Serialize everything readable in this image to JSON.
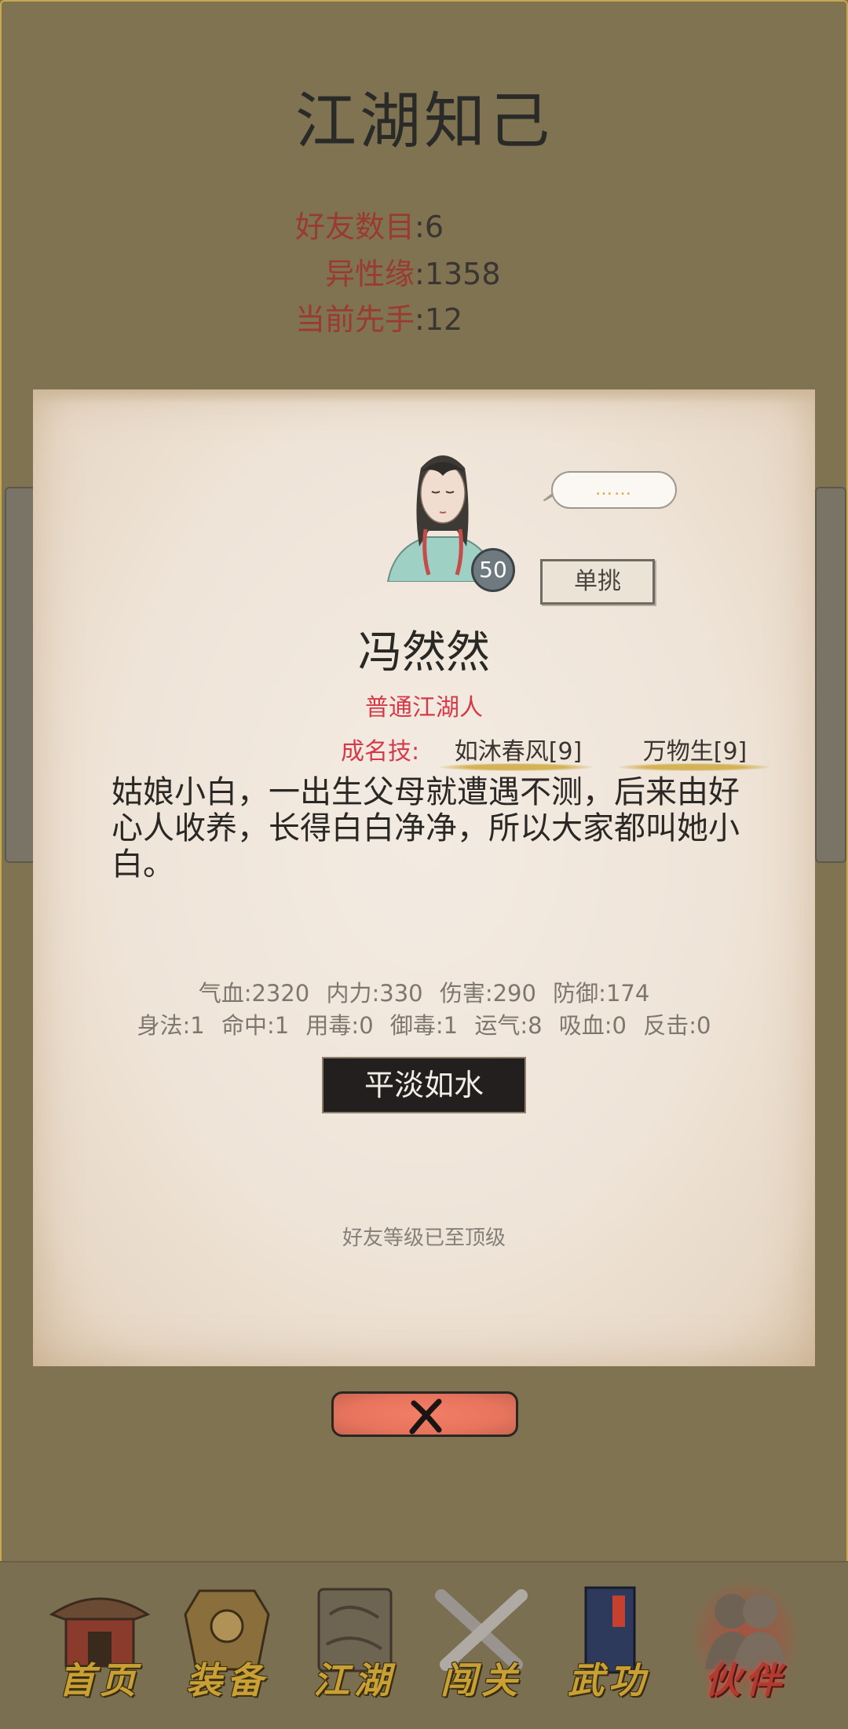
{
  "header": {
    "title": "江湖知己"
  },
  "stats": [
    {
      "label": "好友数目",
      "value": "6"
    },
    {
      "label": "异性缘",
      "value": "1358"
    },
    {
      "label": "当前先手",
      "value": "12"
    }
  ],
  "profile": {
    "level": "50",
    "speech": "……",
    "duel_label": "单挑",
    "name": "冯然然",
    "rank": "普通江湖人",
    "skills_label": "成名技:",
    "skills": [
      "如沐春风[9]",
      "万物生[9]"
    ],
    "bio": "姑娘小白，一出生父母就遭遇不测，后来由好心人收养，长得白白净净，所以大家都叫她小白。",
    "attrs_row1": [
      "气血:2320",
      "内力:330",
      "伤害:290",
      "防御:174"
    ],
    "attrs_row2": [
      "身法:1",
      "命中:1",
      "用毒:0",
      "御毒:1",
      "运气:8",
      "吸血:0",
      "反击:0"
    ],
    "mood_button": "平淡如水",
    "status_note": "好友等级已至顶级"
  },
  "nav": [
    {
      "label": "首页",
      "icon": "building-icon"
    },
    {
      "label": "装备",
      "icon": "armor-icon"
    },
    {
      "label": "江湖",
      "icon": "scroll-map-icon"
    },
    {
      "label": "闯关",
      "icon": "crossed-swords-icon"
    },
    {
      "label": "武功",
      "icon": "book-icon"
    },
    {
      "label": "伙伴",
      "icon": "companions-icon",
      "active": true
    }
  ],
  "colors": {
    "accent_red": "#d63a4a",
    "stat_label": "#9b3a2e",
    "close_button": "#ec7862",
    "nav_gold": "#c9a033"
  }
}
